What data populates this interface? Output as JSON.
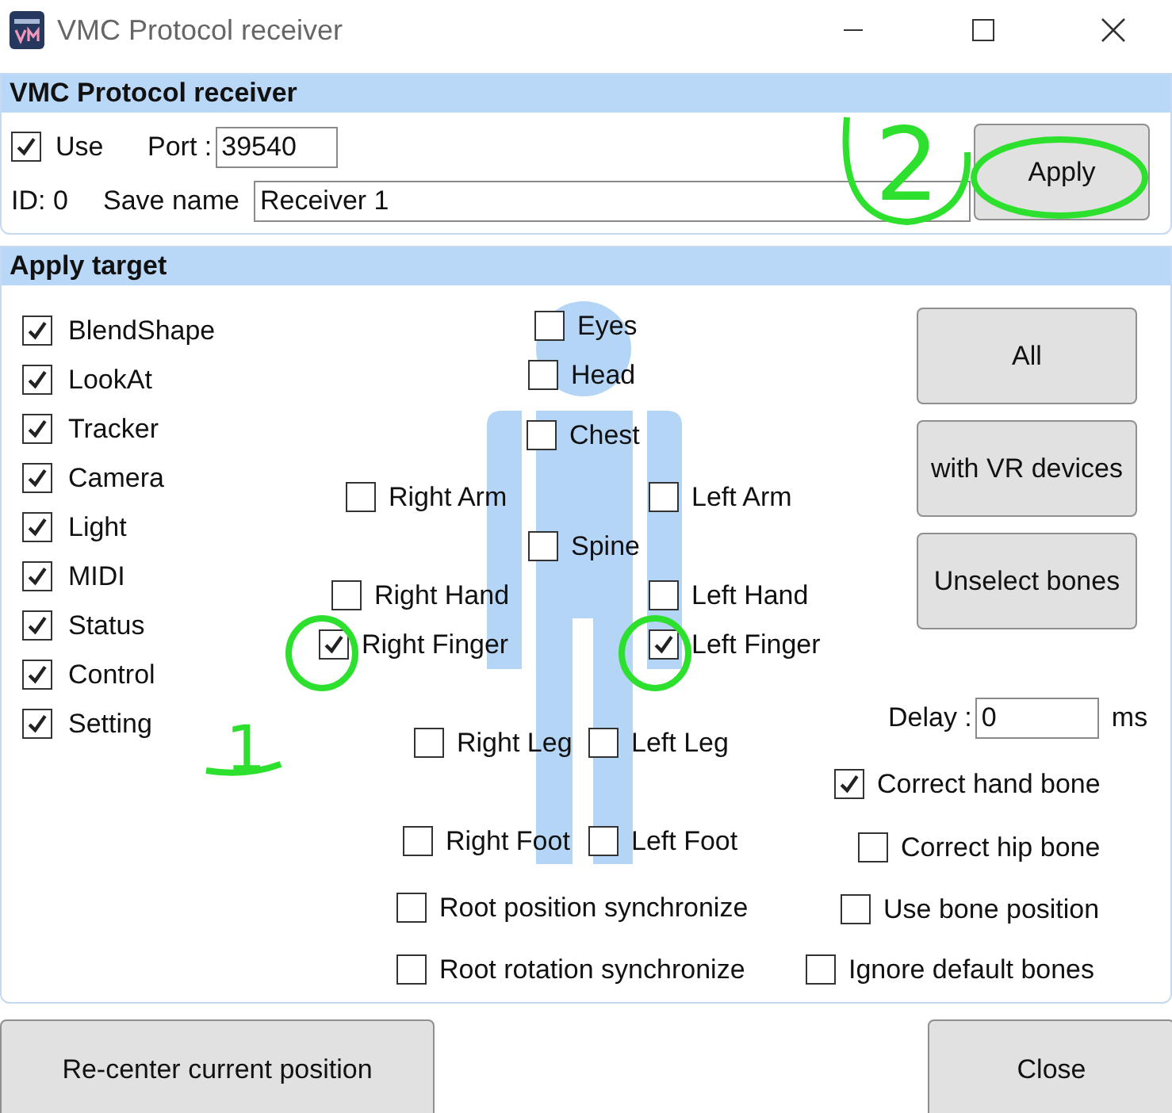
{
  "window": {
    "title": "VMC Protocol receiver"
  },
  "receiver": {
    "header": "VMC Protocol receiver",
    "use": {
      "label": "Use",
      "checked": true
    },
    "port_label": "Port :",
    "port": "39540",
    "id": "ID: 0",
    "save_name_label": "Save name",
    "save_name": "Receiver 1",
    "apply": "Apply"
  },
  "apply_target": {
    "header": "Apply target",
    "items": [
      {
        "label": "BlendShape",
        "checked": true
      },
      {
        "label": "LookAt",
        "checked": true
      },
      {
        "label": "Tracker",
        "checked": true
      },
      {
        "label": "Camera",
        "checked": true
      },
      {
        "label": "Light",
        "checked": true
      },
      {
        "label": "MIDI",
        "checked": true
      },
      {
        "label": "Status",
        "checked": true
      },
      {
        "label": "Control",
        "checked": true
      },
      {
        "label": "Setting",
        "checked": true
      }
    ],
    "bones": [
      {
        "label": "Eyes",
        "checked": false
      },
      {
        "label": "Head",
        "checked": false
      },
      {
        "label": "Chest",
        "checked": false
      },
      {
        "label": "Right Arm",
        "checked": false
      },
      {
        "label": "Left Arm",
        "checked": false
      },
      {
        "label": "Spine",
        "checked": false
      },
      {
        "label": "Right Hand",
        "checked": false
      },
      {
        "label": "Left Hand",
        "checked": false
      },
      {
        "label": "Right Finger",
        "checked": true
      },
      {
        "label": "Left Finger",
        "checked": true
      },
      {
        "label": "Right Leg",
        "checked": false
      },
      {
        "label": "Left Leg",
        "checked": false
      },
      {
        "label": "Right Foot",
        "checked": false
      },
      {
        "label": "Left Foot",
        "checked": false
      }
    ],
    "buttons": [
      "All",
      "with VR devices",
      "Unselect bones"
    ],
    "delay": {
      "label": "Delay :",
      "value": "0",
      "unit": "ms"
    },
    "options": [
      {
        "label": "Correct hand bone",
        "checked": true
      },
      {
        "label": "Correct hip bone",
        "checked": false
      },
      {
        "label": "Use bone position",
        "checked": false
      },
      {
        "label": "Ignore default bones",
        "checked": false
      }
    ],
    "sync": [
      {
        "label": "Root position synchronize",
        "checked": false
      },
      {
        "label": "Root rotation synchronize",
        "checked": false
      }
    ]
  },
  "footer": {
    "recenter": "Re-center current position",
    "close": "Close"
  },
  "annotations": [
    {
      "kind": "number",
      "label": "2"
    },
    {
      "kind": "circle"
    },
    {
      "kind": "circle"
    },
    {
      "kind": "circle"
    },
    {
      "kind": "number",
      "label": "1"
    }
  ]
}
